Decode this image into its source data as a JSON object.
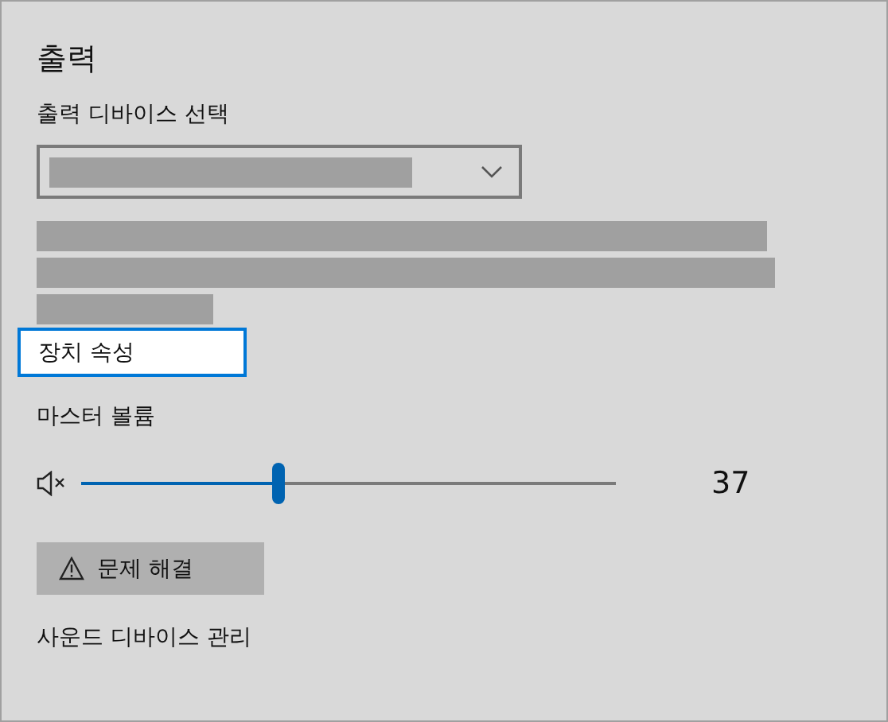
{
  "heading": "출력",
  "device_select": {
    "label": "출력 디바이스 선택"
  },
  "properties_link": {
    "label": "장치 속성",
    "focused": true
  },
  "volume": {
    "label": "마스터 볼륨",
    "level": 0.37,
    "reading": "37"
  },
  "troubleshoot_button": {
    "label": "문제 해결"
  },
  "manage_link": {
    "label": "사운드 디바이스 관리"
  }
}
